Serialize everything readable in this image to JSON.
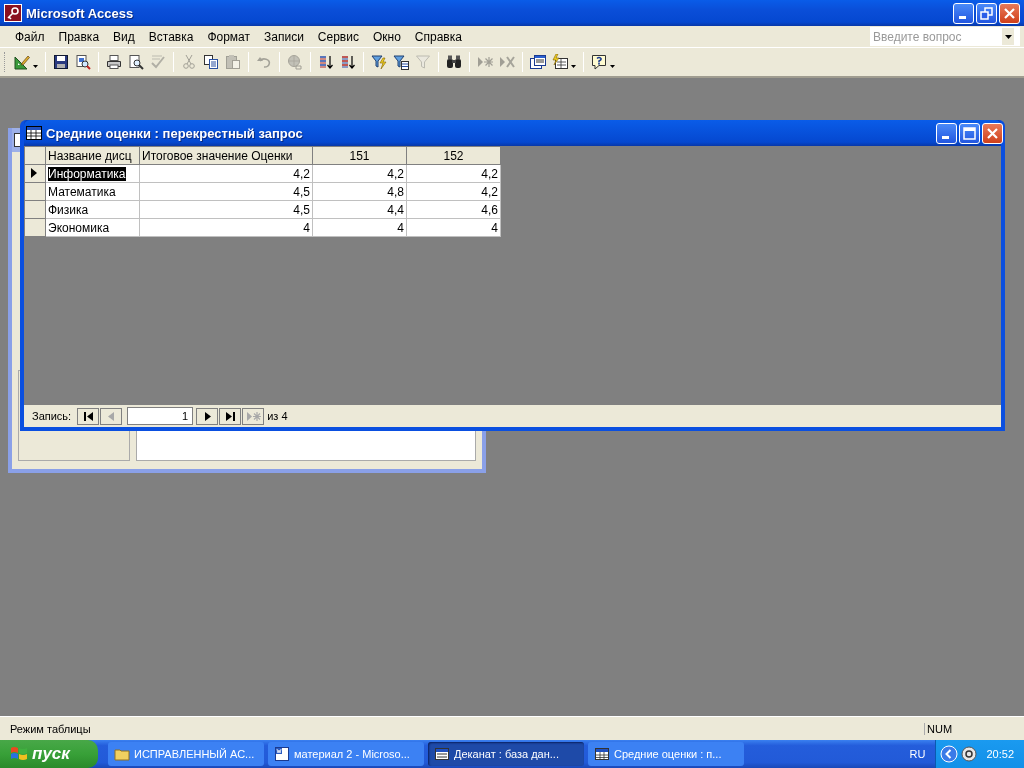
{
  "window": {
    "title": "Microsoft Access"
  },
  "menu": [
    "Файл",
    "Правка",
    "Вид",
    "Вставка",
    "Формат",
    "Записи",
    "Сервис",
    "Окно",
    "Справка"
  ],
  "help_box": {
    "placeholder": "Введите вопрос"
  },
  "toolbar": [
    [
      {
        "disabled": false,
        "dropdown": true
      }
    ],
    [
      {
        "disabled": false,
        "dropdown": false
      },
      {
        "disabled": false,
        "dropdown": false
      }
    ],
    [
      {
        "disabled": false,
        "dropdown": false
      },
      {
        "disabled": false,
        "dropdown": false
      },
      {
        "disabled": true,
        "dropdown": false
      }
    ],
    [
      {
        "disabled": true,
        "dropdown": false
      },
      {
        "disabled": false,
        "dropdown": false
      },
      {
        "disabled": true,
        "dropdown": false
      }
    ],
    [
      {
        "disabled": true,
        "dropdown": false
      }
    ],
    [
      {
        "disabled": true,
        "dropdown": false
      }
    ],
    [
      {
        "disabled": false,
        "dropdown": false
      },
      {
        "disabled": false,
        "dropdown": false
      }
    ],
    [
      {
        "disabled": false,
        "dropdown": false
      },
      {
        "disabled": false,
        "dropdown": false
      },
      {
        "disabled": true,
        "dropdown": false
      }
    ],
    [
      {
        "disabled": false,
        "dropdown": false
      }
    ],
    [
      {
        "disabled": true,
        "dropdown": false
      },
      {
        "disabled": true,
        "dropdown": false
      }
    ],
    [
      {
        "disabled": false,
        "dropdown": false
      },
      {
        "disabled": false,
        "dropdown": true
      }
    ],
    [
      {
        "disabled": false,
        "dropdown": true
      }
    ]
  ],
  "query_window": {
    "title": "Средние оценки : перекрестный запрос",
    "columns": [
      "Название дисц",
      "Итоговое значение Оценки",
      "151",
      "152"
    ],
    "rows": [
      {
        "selected": true,
        "cells": [
          "Информатика",
          "4,2",
          "4,2",
          "4,2"
        ]
      },
      {
        "selected": false,
        "cells": [
          "Математика",
          "4,5",
          "4,8",
          "4,2"
        ]
      },
      {
        "selected": false,
        "cells": [
          "Физика",
          "4,5",
          "4,4",
          "4,6"
        ]
      },
      {
        "selected": false,
        "cells": [
          "Экономика",
          "4",
          "4",
          "4"
        ]
      }
    ],
    "navigator": {
      "label": "Запись:",
      "record": "1",
      "total": "из 4",
      "buttons": [
        {
          "disabled": false
        },
        {
          "disabled": true
        },
        {
          "disabled": false
        },
        {
          "disabled": false
        },
        {
          "disabled": true
        }
      ]
    }
  },
  "status_bar": {
    "mode": "Режим таблицы",
    "num": "NUM"
  },
  "taskbar": {
    "start": "пуск",
    "tasks": [
      {
        "label": "ИСПРАВЛЕННЫЙ АС...",
        "selected": false
      },
      {
        "label": "материал 2 - Microso...",
        "selected": false
      },
      {
        "label": "Деканат : база дан...",
        "selected": true
      },
      {
        "label": "Средние оценки : п...",
        "selected": false
      }
    ],
    "language": "RU",
    "clock": "20:52"
  }
}
